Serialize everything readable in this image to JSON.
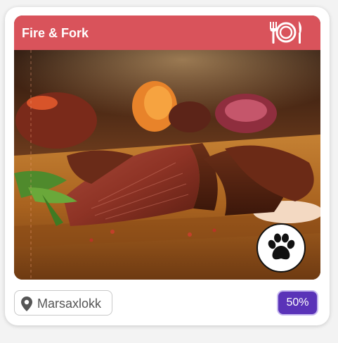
{
  "restaurant": {
    "name": "Fire & Fork",
    "location": "Marsaxlokk",
    "discount": "50%"
  },
  "icons": {
    "header": "fork-plate-knife-icon",
    "badge": "paw-icon",
    "location": "map-pin-icon"
  },
  "colors": {
    "header_bg": "#d9535b",
    "discount_bg": "#5a33b8"
  }
}
